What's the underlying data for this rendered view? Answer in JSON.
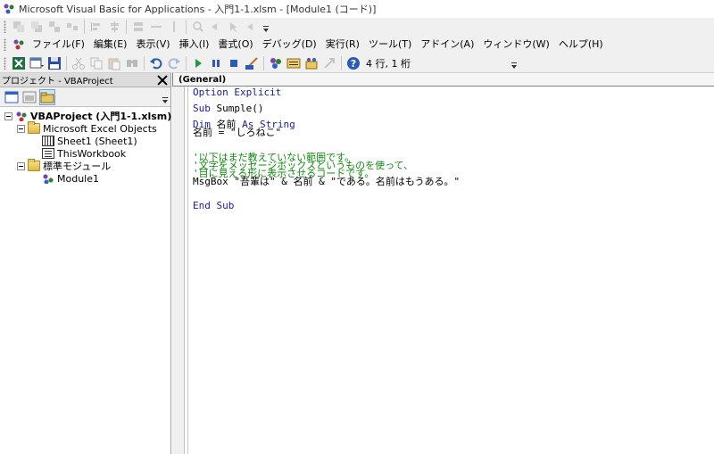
{
  "window": {
    "title": "Microsoft Visual Basic for Applications - 入門1-1.xlsm - [Module1 (コード)]"
  },
  "menu": {
    "items": [
      "ファイル(F)",
      "編集(E)",
      "表示(V)",
      "挿入(I)",
      "書式(O)",
      "デバッグ(D)",
      "実行(R)",
      "ツール(T)",
      "アドイン(A)",
      "ウィンドウ(W)",
      "ヘルプ(H)"
    ]
  },
  "toolbar": {
    "cursor_position": "4 行, 1 桁"
  },
  "project_explorer": {
    "title": "プロジェクト - VBAProject",
    "tree": {
      "project": "VBAProject (入門1-1.xlsm)",
      "excel_objects": "Microsoft Excel Objects",
      "sheet1": "Sheet1 (Sheet1)",
      "thisworkbook": "ThisWorkbook",
      "modules_folder": "標準モジュール",
      "module1": "Module1"
    }
  },
  "code_window": {
    "object_combo": "(General)",
    "code": {
      "line1": "Option Explicit",
      "line2_kw": "Sub",
      "line2_rest": " Sumple()",
      "line3_kw1": "Dim",
      "line3_mid": " 名前 ",
      "line3_kw2": "As String",
      "line4": "名前 = \"しろねこ\"",
      "comment1": "'以下はまだ教えていない範囲です。",
      "comment2": "'文字をメッセージボックスというものを使って、",
      "comment3": "'目に見える形に表示させるコードです。",
      "msgbox": "MsgBox \"吾輩は\" & 名前 & \"である。名前はもうある。\"",
      "end_sub": "End Sub"
    }
  },
  "colors": {
    "keyword": "#1a1aa6",
    "comment": "#108a10"
  }
}
